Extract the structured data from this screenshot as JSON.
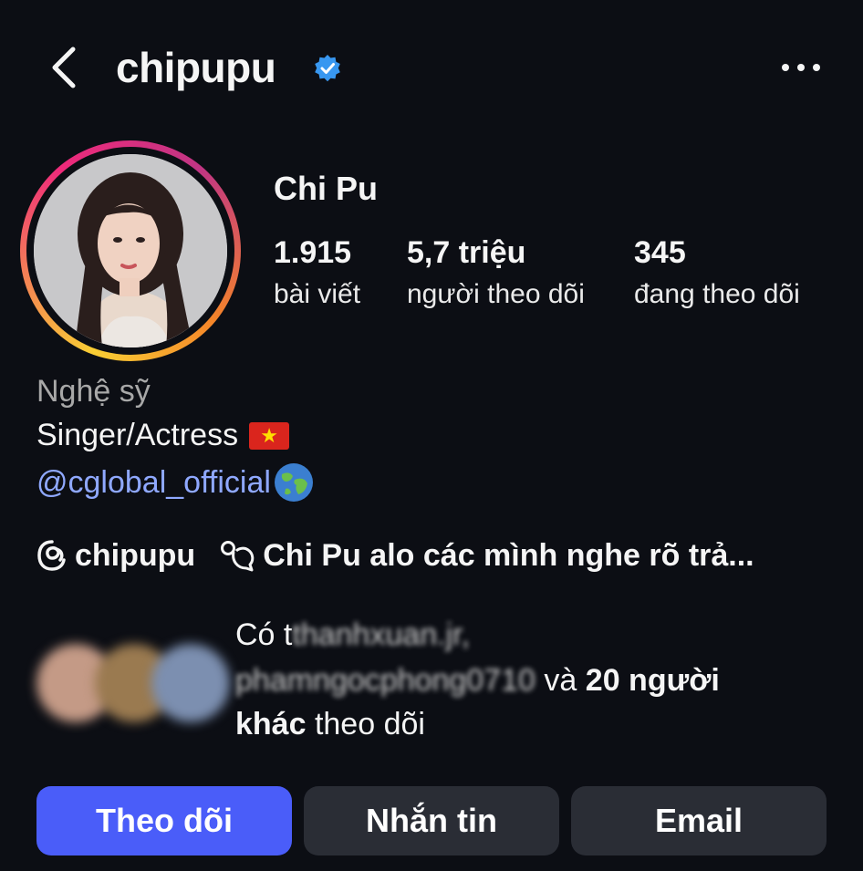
{
  "header": {
    "username": "chipupu",
    "back_icon": "chevron-left-icon",
    "verified_icon": "verified-badge-icon",
    "more_icon": "more-horizontal-icon"
  },
  "profile": {
    "full_name": "Chi Pu",
    "stats": [
      {
        "value": "1.915",
        "label": "bài viết"
      },
      {
        "value": "5,7 triệu",
        "label": "người theo dõi"
      },
      {
        "value": "345",
        "label": "đang theo dõi"
      }
    ],
    "category": "Nghệ sỹ",
    "bio": "Singer/Actress",
    "bio_flag": "★",
    "link": "@cglobal_official",
    "threads_handle": "chipupu",
    "threads_post": "Chi Pu alo các mình nghe rõ trả..."
  },
  "followed_by": {
    "prefix": "Có t",
    "user1": "thanhxuan.jr,",
    "user2": "phamngocphong0710",
    "middle": " và ",
    "count_text": "20 người",
    "line3_bold": "khác",
    "line3_rest": " theo dõi"
  },
  "buttons": {
    "follow": "Theo dõi",
    "message": "Nhắn tin",
    "email": "Email"
  },
  "colors": {
    "background": "#0c0e14",
    "accent": "#4a5df9",
    "link": "#8fa8ff",
    "verified": "#3897f0"
  }
}
